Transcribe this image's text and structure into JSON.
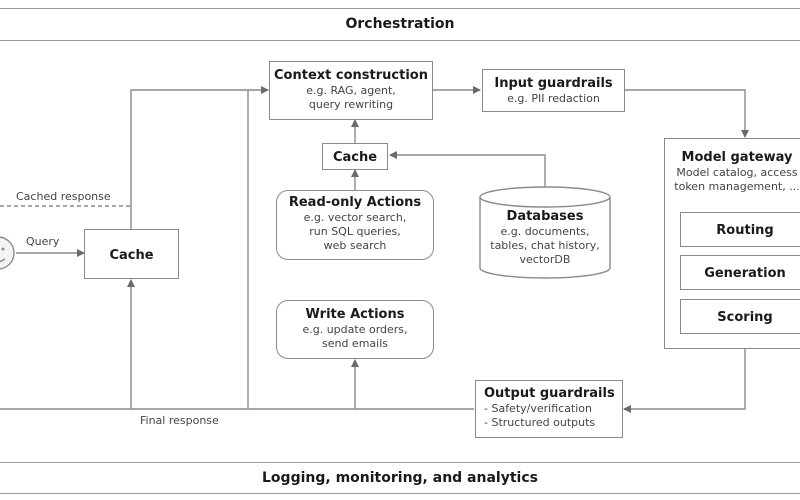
{
  "title": "Orchestration",
  "footer": "Logging, monitoring, and analytics",
  "colors": {
    "line": "#8a8a8a",
    "text": "#1a1a1a",
    "subtext": "#444444"
  },
  "labels": {
    "cached_response": "Cached response",
    "query": "Query",
    "final_response": "Final response"
  },
  "user": {
    "icon": "user-face-icon"
  },
  "nodes": {
    "cache_main": {
      "title": "Cache"
    },
    "context": {
      "title": "Context construction",
      "lines": [
        "e.g. RAG, agent,",
        "query rewriting"
      ]
    },
    "input_guard": {
      "title": "Input guardrails",
      "lines": [
        "e.g. PII redaction"
      ]
    },
    "cache_small": {
      "title": "Cache"
    },
    "read_actions": {
      "title": "Read-only Actions",
      "lines": [
        "e.g. vector search,",
        "run SQL queries,",
        "web search"
      ]
    },
    "databases": {
      "title": "Databases",
      "lines": [
        "e.g. documents,",
        "tables, chat history,",
        "vectorDB"
      ]
    },
    "write_actions": {
      "title": "Write Actions",
      "lines": [
        "e.g. update orders,",
        "send emails"
      ]
    },
    "output_guard": {
      "title": "Output guardrails",
      "lines": [
        "- Safety/verification",
        "- Structured outputs"
      ]
    },
    "gateway": {
      "title": "Model gateway",
      "lines": [
        "Model catalog, access",
        "token management, ..."
      ],
      "children": [
        "Routing",
        "Generation",
        "Scoring"
      ]
    }
  }
}
